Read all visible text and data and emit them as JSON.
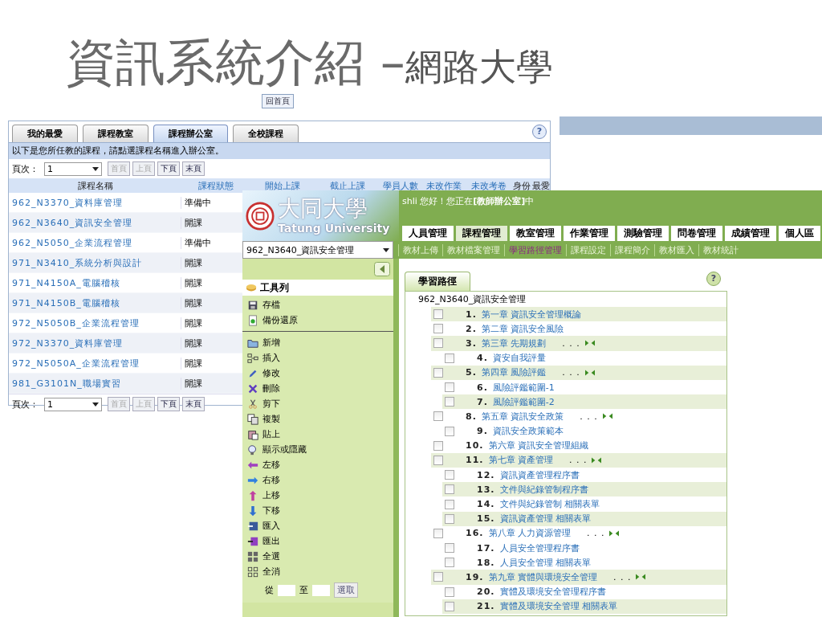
{
  "slide": {
    "title_main": "資訊系統介紹 –",
    "title_sub": "網路大學",
    "home_button": "回首頁"
  },
  "course_list": {
    "tabs": [
      {
        "label": "我的最愛",
        "selected": false
      },
      {
        "label": "課程教室",
        "selected": false
      },
      {
        "label": "課程辦公室",
        "selected": true
      },
      {
        "label": "全校課程",
        "selected": false
      }
    ],
    "help": "?",
    "notice": "以下是您所任教的課程，請點選課程名稱進入辦公室。",
    "pager": {
      "label": "頁次：",
      "page": "1",
      "buttons": [
        {
          "label": "首頁",
          "disabled": true
        },
        {
          "label": "上頁",
          "disabled": true
        },
        {
          "label": "下頁",
          "disabled": false
        },
        {
          "label": "末頁",
          "disabled": false
        }
      ]
    },
    "columns": [
      {
        "label": "課程名稱",
        "sortable": false
      },
      {
        "label": "課程狀態",
        "sortable": true
      },
      {
        "label": "開始上課",
        "sortable": true
      },
      {
        "label": "截止上課",
        "sortable": true
      },
      {
        "label": "學員人數",
        "sortable": true
      },
      {
        "label": "未改作業",
        "sortable": true
      },
      {
        "label": "未改考卷",
        "sortable": true
      },
      {
        "label": "身份",
        "sortable": false
      },
      {
        "label": "最愛",
        "sortable": false
      }
    ],
    "rows": [
      {
        "name": "962_N3370_資料庫管理",
        "status": "準備中"
      },
      {
        "name": "962_N3640_資訊安全管理",
        "status": "開課"
      },
      {
        "name": "962_N5050_企業流程管理",
        "status": "準備中"
      },
      {
        "name": "971_N3410_系統分析與設計",
        "status": "開課"
      },
      {
        "name": "971_N4150A_電腦稽核",
        "status": "開課"
      },
      {
        "name": "971_N4150B_電腦稽核",
        "status": "開課"
      },
      {
        "name": "972_N5050B_企業流程管理",
        "status": "開課"
      },
      {
        "name": "972_N3370_資料庫管理",
        "status": "開課"
      },
      {
        "name": "972_N5050A_企業流程管理",
        "status": "開課"
      },
      {
        "name": "981_G3101N_職場實習",
        "status": "開課"
      }
    ],
    "footer_pager": {
      "label": "頁次：",
      "page": "1",
      "buttons": [
        {
          "label": "首頁",
          "disabled": true
        },
        {
          "label": "上頁",
          "disabled": true
        },
        {
          "label": "下頁",
          "disabled": false
        },
        {
          "label": "末頁",
          "disabled": false
        }
      ]
    }
  },
  "office": {
    "logo": {
      "name": "大同大學",
      "name_en": "Tatung University"
    },
    "greeting": "shli 您好！您正在**[教師辦公室]**中",
    "nav_tabs": [
      {
        "label": "人員管理",
        "selected": false
      },
      {
        "label": "課程管理",
        "selected": true
      },
      {
        "label": "教室管理",
        "selected": false
      },
      {
        "label": "作業管理",
        "selected": false
      },
      {
        "label": "測驗管理",
        "selected": false
      },
      {
        "label": "問卷管理",
        "selected": false
      },
      {
        "label": "成績管理",
        "selected": false
      },
      {
        "label": "個人區",
        "selected": false
      }
    ],
    "course_select": "962_N3640_資訊安全管理",
    "sub_nav": [
      {
        "label": "教材上傳",
        "selected": false
      },
      {
        "label": "教材檔案管理",
        "selected": false
      },
      {
        "label": "學習路徑管理",
        "selected": true
      },
      {
        "label": "課程設定",
        "selected": false
      },
      {
        "label": "課程簡介",
        "selected": false
      },
      {
        "label": "教材匯入",
        "selected": false
      },
      {
        "label": "教材統計",
        "selected": false
      }
    ],
    "toolbar": {
      "title": "工具列",
      "groups": [
        [
          {
            "kind": "save",
            "label": "存檔"
          },
          {
            "kind": "restore",
            "label": "備份還原"
          }
        ],
        [
          {
            "kind": "new",
            "label": "新增"
          },
          {
            "kind": "insert",
            "label": "插入"
          },
          {
            "kind": "edit",
            "label": "修改"
          },
          {
            "kind": "delete",
            "label": "刪除"
          },
          {
            "kind": "cut",
            "label": "剪下"
          },
          {
            "kind": "copy",
            "label": "複製"
          },
          {
            "kind": "paste",
            "label": "貼上"
          },
          {
            "kind": "toggle",
            "label": "顯示或隱藏"
          },
          {
            "kind": "left",
            "label": "左移"
          },
          {
            "kind": "right",
            "label": "右移"
          },
          {
            "kind": "up",
            "label": "上移"
          },
          {
            "kind": "down",
            "label": "下移"
          },
          {
            "kind": "import",
            "label": "匯入"
          },
          {
            "kind": "export",
            "label": "匯出"
          },
          {
            "kind": "select_all",
            "label": "全選"
          },
          {
            "kind": "clear_all",
            "label": "全消"
          }
        ]
      ],
      "range_from": "從",
      "range_to": "至",
      "range_button": "選取"
    },
    "path_tab": {
      "label": "學習路徑",
      "selected": true
    },
    "help": "?",
    "tree": {
      "root": "962_N3640_資訊安全管理",
      "items": [
        {
          "number": "1.",
          "title": "第一章 資訊安全管理概論",
          "checked": false,
          "highlighted": true
        },
        {
          "number": "2.",
          "title": "第二章 資訊安全風險",
          "checked": false,
          "highlighted": false
        },
        {
          "number": "3.",
          "title": "第三章 先期規劃",
          "checked": false,
          "highlighted": true,
          "more": ". . .",
          "children": [
            {
              "number": "4.",
              "title": "資安自我評量",
              "checked": false,
              "highlighted": false
            }
          ]
        },
        {
          "number": "5.",
          "title": "第四章 風險評鑑",
          "checked": false,
          "highlighted": true,
          "more": ". . .",
          "children": [
            {
              "number": "6.",
              "title": "風險評鑑範圍-1",
              "checked": false,
              "highlighted": false
            },
            {
              "number": "7.",
              "title": "風險評鑑範圍-2",
              "checked": false,
              "highlighted": true
            }
          ]
        },
        {
          "number": "8.",
          "title": "第五章 資訊安全政策",
          "checked": false,
          "highlighted": false,
          "more": ". . .",
          "children": [
            {
              "number": "9.",
              "title": "資訊安全政策範本",
              "checked": false,
              "highlighted": false
            }
          ]
        },
        {
          "number": "10.",
          "title": "第六章 資訊安全管理組織",
          "checked": false,
          "highlighted": false
        },
        {
          "number": "11.",
          "title": "第七章 資產管理",
          "checked": false,
          "highlighted": true,
          "more": ". . .",
          "children": [
            {
              "number": "12.",
              "title": "資訊資產管理程序書",
              "checked": false,
              "highlighted": false
            },
            {
              "number": "13.",
              "title": "文件與紀錄管制程序書",
              "checked": false,
              "highlighted": true
            },
            {
              "number": "14.",
              "title": "文件與紀錄管制 相關表單",
              "checked": false,
              "highlighted": false
            },
            {
              "number": "15.",
              "title": "資訊資產管理 相關表單",
              "checked": false,
              "highlighted": true
            }
          ]
        },
        {
          "number": "16.",
          "title": "第八章 人力資源管理",
          "checked": false,
          "highlighted": false,
          "more": ". . .",
          "children": [
            {
              "number": "17.",
              "title": "人員安全管理程序書",
              "checked": false,
              "highlighted": false
            },
            {
              "number": "18.",
              "title": "人員安全管理 相關表單",
              "checked": false,
              "highlighted": false
            }
          ]
        },
        {
          "number": "19.",
          "title": "第九章 實體與環境安全管理",
          "checked": false,
          "highlighted": true,
          "more": ". . .",
          "children": [
            {
              "number": "20.",
              "title": "實體及環境安全管理程序書",
              "checked": false,
              "highlighted": false
            },
            {
              "number": "21.",
              "title": "實體及環境安全管理 相關表單",
              "checked": false,
              "highlighted": true
            }
          ]
        }
      ]
    }
  }
}
